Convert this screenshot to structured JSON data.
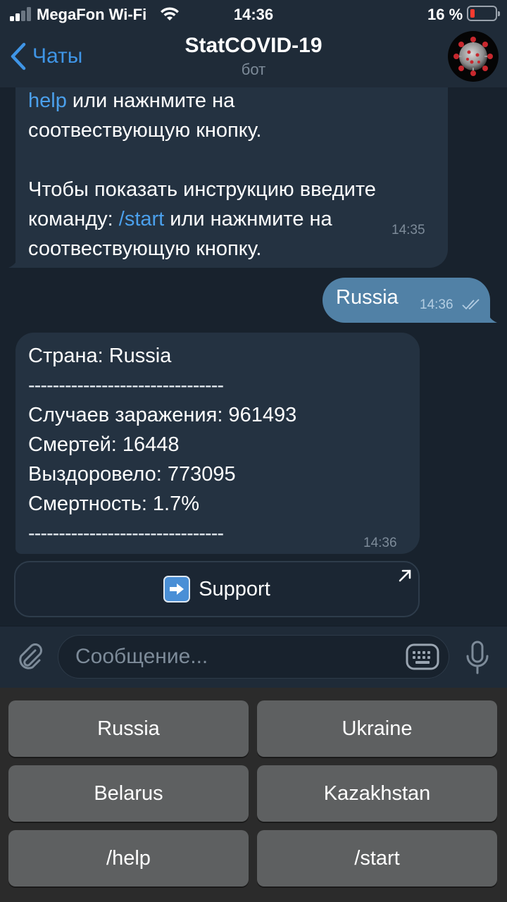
{
  "status_bar": {
    "carrier": "MegaFon Wi-Fi",
    "time": "14:36",
    "battery_percent": "16 %"
  },
  "nav": {
    "back_label": "Чаты",
    "title": "StatCOVID-19",
    "subtitle": "бот"
  },
  "messages": {
    "m1": {
      "line1_link": "help",
      "line1_rest": " или нажнмите на",
      "line2": "соотвествующую кнопку.",
      "line3": "Чтобы показать инструкцию введите",
      "line4_pre": "команду: ",
      "line4_link": "/start",
      "line4_rest": " или нажнмите на",
      "line5": "соотвествующую кнопку.",
      "time": "14:35"
    },
    "out": {
      "text": "Russia",
      "time": "14:36"
    },
    "m2": {
      "lines": [
        "Страна: Russia",
        "--------------------------------",
        "Случаев заражения: 961493",
        "Смертей: 16448",
        "Выздоровело: 773095",
        "Смертность: 1.7%",
        "--------------------------------"
      ],
      "time": "14:36"
    }
  },
  "inline_button": {
    "label": "Support",
    "icon": "arrow-right-emoji"
  },
  "composer": {
    "placeholder": "Сообщение..."
  },
  "keyboard": {
    "buttons": [
      "Russia",
      "Ukraine",
      "Belarus",
      "Kazakhstan",
      "/help",
      "/start"
    ]
  },
  "colors": {
    "background": "#18222d",
    "bubble_in": "#243241",
    "bubble_out": "#5181a6",
    "accent": "#3f95e6",
    "keyboard_button": "#5e6061"
  }
}
